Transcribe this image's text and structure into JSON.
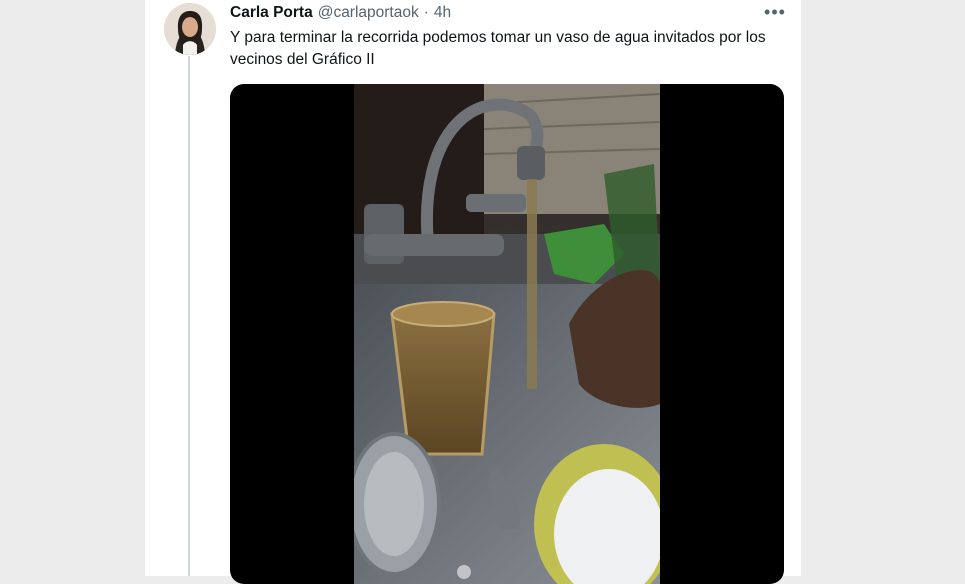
{
  "tweet": {
    "author_name": "Carla Porta",
    "handle": "@carlaportaok",
    "separator": "·",
    "time": "4h",
    "more_icon": "more-horizontal-icon",
    "text": "Y para terminar la recorrida podemos tomar un vaso de agua invitados por los vecinos del Gráfico II"
  },
  "media": {
    "type": "video"
  },
  "colors": {
    "text_primary": "#0f1419",
    "text_secondary": "#536471",
    "thread_line": "#cfd9de",
    "background_outer": "#ececec"
  }
}
